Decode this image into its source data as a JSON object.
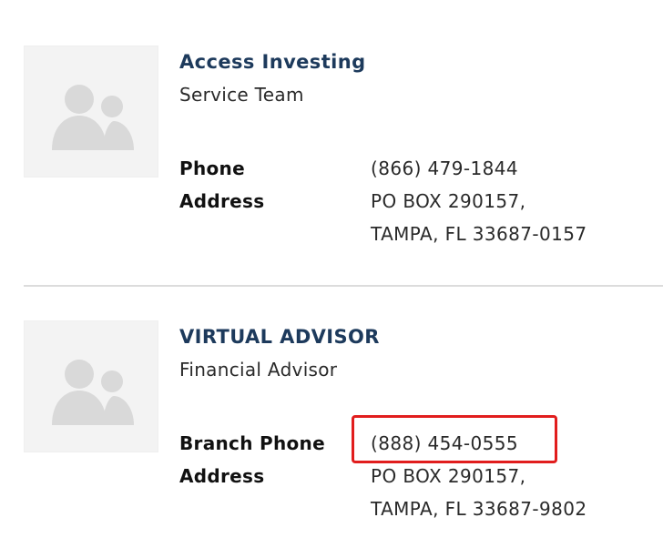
{
  "contacts": [
    {
      "name": "Access Investing",
      "role": "Service Team",
      "phone_label": "Phone",
      "phone": "(866) 479-1844",
      "address_label": "Address",
      "address_line1": "PO BOX 290157,",
      "address_line2": "TAMPA, FL 33687-0157"
    },
    {
      "name": "VIRTUAL ADVISOR",
      "role": "Financial Advisor",
      "phone_label": "Branch Phone",
      "phone": "(888) 454-0555",
      "address_label": "Address",
      "address_line1": "PO BOX 290157,",
      "address_line2": "TAMPA, FL 33687-9802"
    }
  ],
  "icons": {
    "avatar": "people-placeholder-icon"
  },
  "colors": {
    "name": "#1d3a5c",
    "highlight": "#e11d1d",
    "avatar_bg": "#f3f3f3",
    "avatar_figure": "#d9d9d9",
    "divider": "#dcdcdc"
  }
}
